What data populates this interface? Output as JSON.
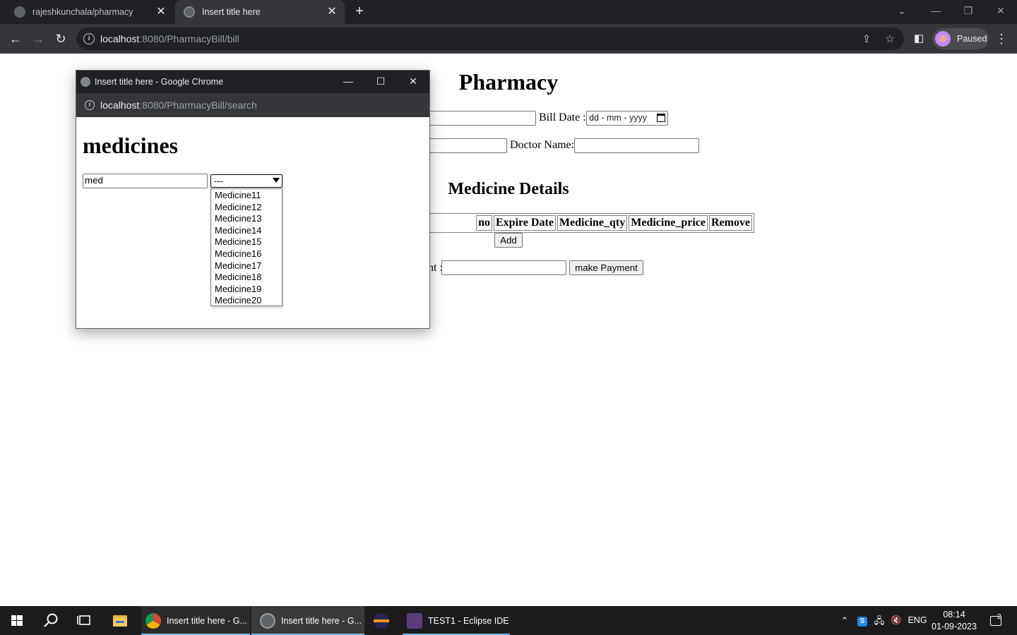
{
  "browser": {
    "tabs": [
      {
        "title": "rajeshkunchala/pharmacy",
        "active": false
      },
      {
        "title": "Insert title here",
        "active": true
      }
    ],
    "url_host": "localhost",
    "url_path": ":8080/PharmacyBill/bill",
    "profile_label": "Paused"
  },
  "page": {
    "title": "Pharmacy",
    "bill_date_label": "Bill Date :",
    "bill_date_placeholder": "dd - mm - yyyy",
    "doctor_name_label": "Doctor Name:",
    "section_title": "Medicine Details",
    "table_headers": [
      "no",
      "Expire Date",
      "Medicine_qty",
      "Medicine_price",
      "Remove"
    ],
    "add_button": "Add",
    "amount_label_partial": "nt :",
    "payment_button": "make Payment"
  },
  "popup": {
    "window_title": "Insert title here - Google Chrome",
    "url_host": "localhost",
    "url_path": ":8080/PharmacyBill/search",
    "heading": "medicines",
    "search_value": "med",
    "select_value": "---",
    "options": [
      "Medicine11",
      "Medicine12",
      "Medicine13",
      "Medicine14",
      "Medicine15",
      "Medicine16",
      "Medicine17",
      "Medicine18",
      "Medicine19",
      "Medicine20"
    ]
  },
  "taskbar": {
    "apps": [
      {
        "label": "Insert title here - G...",
        "icon": "chrome-icon"
      },
      {
        "label": "Insert title here - G...",
        "icon": "chrome-popup-icon"
      },
      {
        "label": "",
        "icon": "eclipse-icon"
      },
      {
        "label": "TEST1 - Eclipse IDE",
        "icon": "eclipse-ide-icon"
      }
    ],
    "language": "ENG",
    "time": "08:14",
    "date": "01-09-2023",
    "notification_count": "2"
  },
  "colors": {
    "chrome_dark": "#202124",
    "chrome_toolbar": "#35363a",
    "taskbar": "#1c1c1c",
    "accent": "#76b9ed"
  }
}
